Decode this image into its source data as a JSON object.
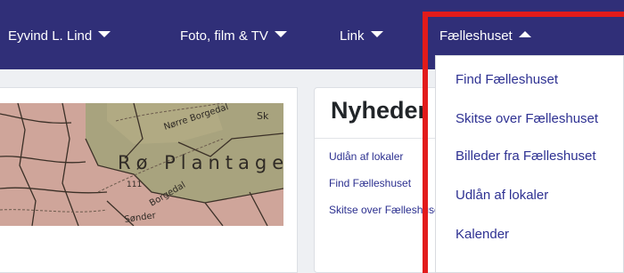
{
  "navbar": {
    "items": [
      {
        "label": "Eyvind L. Lind",
        "caret": "down"
      },
      {
        "label": "Foto, film & TV",
        "caret": "down"
      },
      {
        "label": "Link",
        "caret": "down"
      },
      {
        "label": "Fælleshuset",
        "caret": "up"
      }
    ],
    "background": "#302f78"
  },
  "map": {
    "labels": [
      "Nørre Borgedal",
      "Sk",
      "Rø Plantage",
      "111",
      "Borgedal",
      "Sønder"
    ]
  },
  "news": {
    "title": "Nyheder",
    "links": [
      "Udlån af lokaler",
      "Find Fælleshuset",
      "Skitse over Fælleshuset"
    ]
  },
  "dropdown": {
    "items": [
      "Find Fælleshuset",
      "Skitse over Fælleshuset",
      "Billeder fra Fælleshuset",
      "Udlån af lokaler",
      "Kalender"
    ],
    "link_color": "#2e3192"
  },
  "highlight": {
    "color": "#e21b1b"
  }
}
